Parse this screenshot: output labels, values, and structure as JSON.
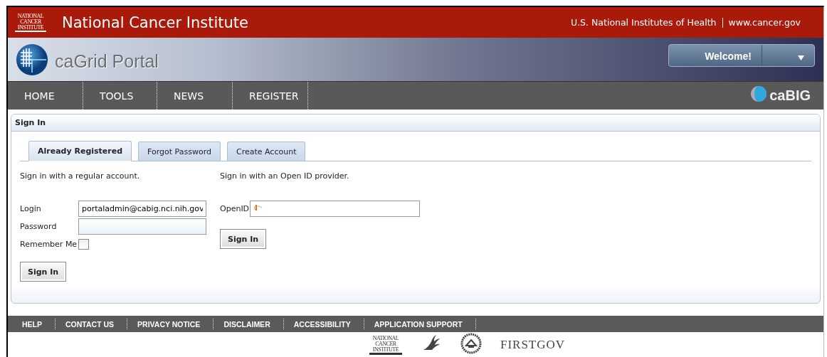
{
  "header": {
    "logo_text": "NATIONAL CANCER INSTITUTE",
    "title": "National Cancer Institute",
    "links": [
      "U.S. National Institutes of Health",
      "www.cancer.gov"
    ]
  },
  "banner": {
    "title": "caGrid Portal",
    "welcome_button": "Welcome!"
  },
  "nav": {
    "items": [
      {
        "label": "HOME"
      },
      {
        "label": "TOOLS"
      },
      {
        "label": "NEWS"
      },
      {
        "label": "REGISTER"
      }
    ],
    "logo_text": "caBIG"
  },
  "panel": {
    "title": "Sign In",
    "tabs": [
      {
        "label": "Already Registered",
        "selected": true
      },
      {
        "label": "Forgot Password",
        "selected": false
      },
      {
        "label": "Create Account",
        "selected": false
      }
    ],
    "regular": {
      "intro": "Sign in with a regular account.",
      "login_label": "Login",
      "login_value": "portaladmin@cabig.nci.nih.gov",
      "password_label": "Password",
      "remember_label": "Remember Me",
      "remember_checked": false,
      "button": "Sign In"
    },
    "openid": {
      "intro": "Sign in with an Open ID provider.",
      "label": "OpenID",
      "button": "Sign In"
    }
  },
  "footer": {
    "links": [
      "HELP",
      "CONTACT US",
      "PRIVACY NOTICE",
      "DISCLAIMER",
      "ACCESSIBILITY",
      "APPLICATION SUPPORT"
    ],
    "nci_logo_text": "NATIONAL CANCER INSTITUTE",
    "firstgov_text": "FIRSTGOV"
  }
}
